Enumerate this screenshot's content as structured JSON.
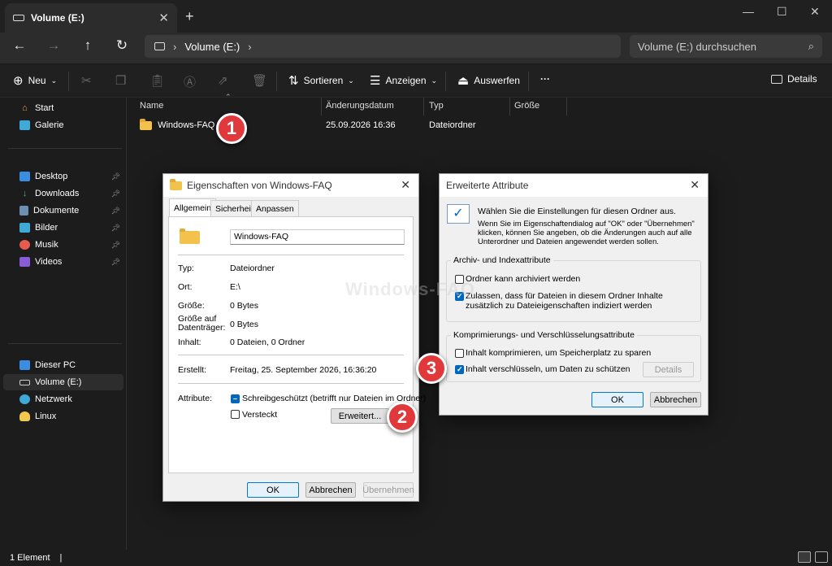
{
  "window": {
    "tab_title": "Volume (E:)",
    "controls": {
      "minimize": "—",
      "maximize": "☐",
      "close": "✕"
    }
  },
  "nav": {
    "breadcrumb_current": "Volume (E:)",
    "search_placeholder": "Volume (E:) durchsuchen"
  },
  "commandbar": {
    "new_label": "Neu",
    "sort_label": "Sortieren",
    "view_label": "Anzeigen",
    "eject_label": "Auswerfen",
    "more_label": "···",
    "details_label": "Details"
  },
  "sidebar": {
    "top": [
      {
        "label": "Start",
        "icon": "home-icon"
      },
      {
        "label": "Galerie",
        "icon": "gallery-icon"
      }
    ],
    "pinned": [
      {
        "label": "Desktop",
        "icon": "desktop-icon"
      },
      {
        "label": "Downloads",
        "icon": "download-icon"
      },
      {
        "label": "Dokumente",
        "icon": "document-icon"
      },
      {
        "label": "Bilder",
        "icon": "picture-icon"
      },
      {
        "label": "Musik",
        "icon": "music-icon"
      },
      {
        "label": "Videos",
        "icon": "video-icon"
      }
    ],
    "drives": [
      {
        "label": "Dieser PC",
        "icon": "pc-icon"
      },
      {
        "label": "Volume (E:)",
        "icon": "drive-icon"
      },
      {
        "label": "Netzwerk",
        "icon": "network-icon"
      },
      {
        "label": "Linux",
        "icon": "linux-icon"
      }
    ]
  },
  "filelist": {
    "columns": [
      "Name",
      "Änderungsdatum",
      "Typ",
      "Größe"
    ],
    "rows": [
      {
        "name": "Windows-FAQ",
        "date": "25.09.2026 16:36",
        "type": "Dateiordner",
        "size": ""
      }
    ]
  },
  "badges": [
    "1",
    "2",
    "3"
  ],
  "status": {
    "count": "1 Element",
    "separator": "|"
  },
  "watermark": "Windows-FAQ",
  "props_dialog": {
    "title": "Eigenschaften von Windows-FAQ",
    "tabs": [
      "Allgemein",
      "Sicherheit",
      "Anpassen"
    ],
    "folder_name": "Windows-FAQ",
    "rows": [
      {
        "label": "Typ:",
        "value": "Dateiordner"
      },
      {
        "label": "Ort:",
        "value": "E:\\"
      },
      {
        "label": "Größe:",
        "value": "0 Bytes"
      },
      {
        "label": "Größe auf Datenträger:",
        "value": "0 Bytes"
      },
      {
        "label": "Inhalt:",
        "value": "0 Dateien, 0 Ordner"
      }
    ],
    "created_label": "Erstellt:",
    "created_value": "Freitag, 25. September 2026, 16:36:20",
    "attributes_label": "Attribute:",
    "readonly_label": "Schreibgeschützt (betrifft nur Dateien im Ordner)",
    "hidden_label": "Versteckt",
    "advanced_button": "Erweitert...",
    "ok": "OK",
    "cancel": "Abbrechen",
    "apply": "Übernehmen"
  },
  "adv_dialog": {
    "title": "Erweiterte Attribute",
    "intro": "Wählen Sie die Einstellungen für diesen Ordner aus.",
    "intro2": "Wenn Sie im Eigenschaftendialog auf \"OK\" oder \"Übernehmen\" klicken, können Sie angeben, ob die Änderungen auch auf alle Unterordner und Dateien angewendet werden sollen.",
    "group1_title": "Archiv- und Indexattribute",
    "archive_label": "Ordner kann archiviert werden",
    "index_label": "Zulassen, dass für Dateien in diesem Ordner Inhalte zusätzlich zu Dateieigenschaften indiziert werden",
    "group2_title": "Komprimierungs- und Verschlüsselungsattribute",
    "compress_label": "Inhalt komprimieren, um Speicherplatz zu sparen",
    "encrypt_label": "Inhalt verschlüsseln, um Daten zu schützen",
    "details_button": "Details",
    "ok": "OK",
    "cancel": "Abbrechen"
  }
}
